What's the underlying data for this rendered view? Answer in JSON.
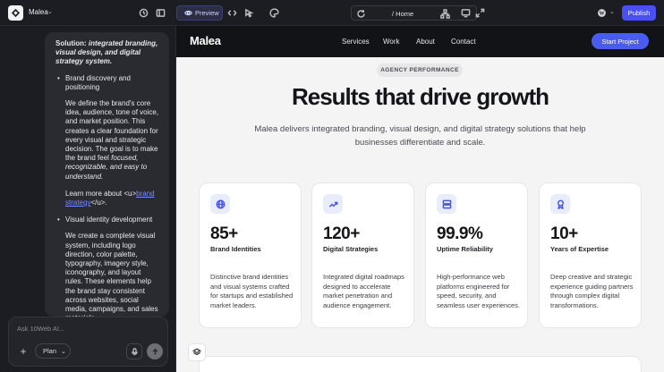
{
  "topbar": {
    "project_name": "Malea",
    "preview_label": "Preview",
    "address_path": "/ Home",
    "publish_label": "Publish"
  },
  "chat": {
    "solution_prefix": "Solution: ",
    "solution_text": "integrated branding, visual design, and digital strategy system.",
    "item1_title": "Brand discovery and positioning",
    "item1_body_a": "We define the brand's core idea, audience, tone of voice, and market position. This creates a clear foundation for every visual and strategic decision. The goal is to make the brand feel ",
    "item1_body_em": "focused, recognizable, and easy to understand.",
    "learn_prefix": "Learn more about <u>",
    "learn_link": "brand strategy",
    "learn_suffix": "</u>.",
    "item2_title": "Visual identity development",
    "item2_body": "We create a complete visual system, including logo direction, color palette, typography, imagery style, iconography, and layout rules. These elements help the brand stay consistent across websites, social media, campaigns, and sales materials.",
    "input_placeholder": "Ask 10Web AI...",
    "plan_label": "Plan"
  },
  "site": {
    "brand": "Malea",
    "nav": [
      "Services",
      "Work",
      "About",
      "Contact"
    ],
    "cta": "Start Project",
    "pill": "AGENCY PERFORMANCE",
    "headline": "Results that drive growth",
    "subheadline": "Malea delivers integrated branding, visual design, and digital strategy solutions that help businesses differentiate and scale.",
    "cards": [
      {
        "icon": "globe-icon",
        "value": "85+",
        "label": "Brand Identities",
        "desc": "Distinctive brand identities and visual systems crafted for startups and established market leaders."
      },
      {
        "icon": "trend-up-icon",
        "value": "120+",
        "label": "Digital Strategies",
        "desc": "Integrated digital roadmaps designed to accelerate market penetration and audience engagement."
      },
      {
        "icon": "server-icon",
        "value": "99.9%",
        "label": "Uptime Reliability",
        "desc": "High-performance web platforms engineered for speed, security, and seamless user experiences."
      },
      {
        "icon": "award-icon",
        "value": "10+",
        "label": "Years of Expertise",
        "desc": "Deep creative and strategic experience guiding partners through complex digital transformations."
      }
    ]
  },
  "colors": {
    "accent": "#4a5cf0",
    "publish": "#4a4ff0",
    "app_bg": "#1c1d22",
    "preview_bg": "#f4f4f5"
  }
}
